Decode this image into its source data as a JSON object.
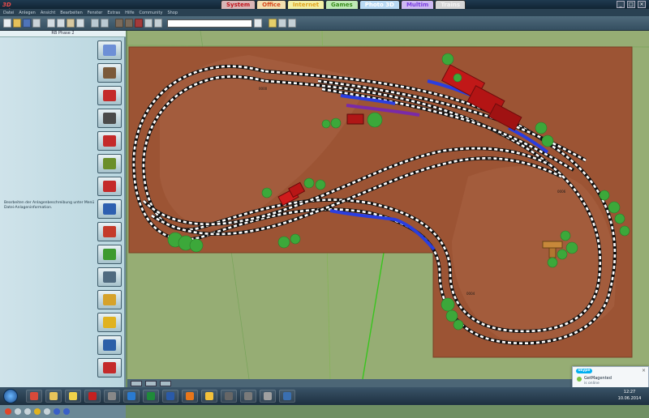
{
  "app": {
    "logo_text": "3D Mb.Pro"
  },
  "top_tabs": [
    {
      "label": "System",
      "bg": "#d9b6b6",
      "color": "#c0131b"
    },
    {
      "label": "Office",
      "bg": "#f3dfb0",
      "color": "#d7491c"
    },
    {
      "label": "Internet",
      "bg": "#f3f0a6",
      "color": "#e0a21c"
    },
    {
      "label": "Games",
      "bg": "#bfe9b6",
      "color": "#3a8d1e"
    },
    {
      "label": "Photo 3D",
      "bg": "#b9d9f4",
      "color": "#ffffff"
    },
    {
      "label": "Multim",
      "bg": "#cdb9f2",
      "color": "#7a3ee0"
    },
    {
      "label": "Trains",
      "bg": "#d6d6d6",
      "color": "#f3f3f3"
    }
  ],
  "window_controls": [
    "_",
    "□",
    "×"
  ],
  "menu": [
    "Datei",
    "Anlegen",
    "Ansicht",
    "Bearbeiten",
    "Fenster",
    "Extras",
    "Hilfe",
    "Community",
    "Shop"
  ],
  "toolbar": {
    "search_value": ""
  },
  "left_panel": {
    "title": "RB Phase 2",
    "info_text": "Bearbeiten der Anlagenbeschreibung unter Menü Datei-Anlageninformation.",
    "tools": [
      {
        "name": "view-cube-icon",
        "color": "#6d8fd6"
      },
      {
        "name": "track-icon",
        "color": "#7b5a3a"
      },
      {
        "name": "track-red-icon",
        "color": "#c42a2a"
      },
      {
        "name": "road-icon",
        "color": "#4a4a4a"
      },
      {
        "name": "road-red-icon",
        "color": "#c42a2a"
      },
      {
        "name": "signal-icon",
        "color": "#6b8f2a"
      },
      {
        "name": "signal-red-icon",
        "color": "#c42a2a"
      },
      {
        "name": "people-icon",
        "color": "#2d5fb0"
      },
      {
        "name": "house-icon",
        "color": "#c43a2a"
      },
      {
        "name": "tree-icon",
        "color": "#3c9a2f"
      },
      {
        "name": "landscape-icon",
        "color": "#4f6a7f"
      },
      {
        "name": "sign-post-icon",
        "color": "#d6a22a"
      },
      {
        "name": "box-icon",
        "color": "#e0b21f"
      },
      {
        "name": "water-icon",
        "color": "#2c5fa8"
      },
      {
        "name": "water-red-icon",
        "color": "#c42a2a"
      }
    ]
  },
  "colors": {
    "board": "#9c5434",
    "green_base": "#96ad74",
    "track_bed": "#111111",
    "sleeper": "#ffffff",
    "highlight_blue": "#2a3ee0",
    "highlight_purple": "#7a2aa8",
    "building_red": "#c11818",
    "tree_green": "#3ca83a"
  },
  "taskbar": {
    "apps": [
      {
        "name": "chrome-icon",
        "color": "#d94a3a"
      },
      {
        "name": "folder-icon",
        "color": "#e7c35a"
      },
      {
        "name": "paint-icon",
        "color": "#f0d24a"
      },
      {
        "name": "filezilla-icon",
        "color": "#c42020"
      },
      {
        "name": "game-controller-icon",
        "color": "#888888"
      },
      {
        "name": "photoshop-icon",
        "color": "#2a7ad0"
      },
      {
        "name": "excel-icon",
        "color": "#1f8a3a"
      },
      {
        "name": "word-icon",
        "color": "#2a5aa8"
      },
      {
        "name": "firefox-icon",
        "color": "#e8761a"
      },
      {
        "name": "sun-icon",
        "color": "#f4c13a"
      },
      {
        "name": "film-icon",
        "color": "#666666"
      },
      {
        "name": "train-app-icon",
        "color": "#7a7a7a"
      },
      {
        "name": "tools-icon",
        "color": "#a0a0a0"
      },
      {
        "name": "3d-app-icon",
        "color": "#3a6fb0"
      }
    ],
    "time": "12:27",
    "date": "10.06.2014"
  },
  "skype_toast": {
    "logo": "skype",
    "name": "GetMagented",
    "status": "is online"
  }
}
